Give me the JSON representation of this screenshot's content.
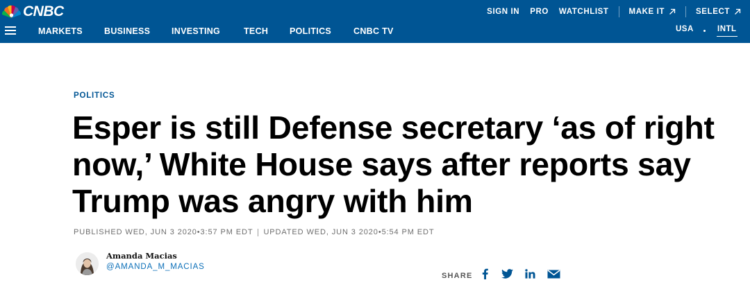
{
  "header": {
    "logo_text": "CNBC",
    "top_links": [
      {
        "label": "SIGN IN"
      },
      {
        "label": "PRO"
      },
      {
        "label": "WATCHLIST"
      },
      {
        "label": "MAKE IT"
      },
      {
        "label": "SELECT"
      }
    ],
    "nav": [
      {
        "label": "MARKETS"
      },
      {
        "label": "BUSINESS"
      },
      {
        "label": "INVESTING"
      },
      {
        "label": "TECH"
      },
      {
        "label": "POLITICS"
      },
      {
        "label": "CNBC TV"
      }
    ],
    "editions": [
      {
        "label": "USA"
      },
      {
        "label": "INTL"
      }
    ],
    "selected_edition": "INTL"
  },
  "article": {
    "section": "POLITICS",
    "headline": "Esper is still Defense secretary ‘as of right now,’ White House says after reports say Trump was angry with him",
    "published": "PUBLISHED WED, JUN 3 2020•3:57 PM EDT",
    "updated": "UPDATED WED, JUN 3 2020•5:54 PM EDT",
    "author": {
      "name": "Amanda Macias",
      "handle": "@AMANDA_M_MACIAS"
    },
    "share_label": "SHARE",
    "share_icons": [
      "facebook-icon",
      "twitter-icon",
      "linkedin-icon",
      "email-icon"
    ]
  },
  "colors": {
    "header_bg": "#005594",
    "section_label": "#005594",
    "author_handle": "#0b6fb8",
    "share_icons": "#005594",
    "timestamp_text": "#6e6e6e"
  }
}
